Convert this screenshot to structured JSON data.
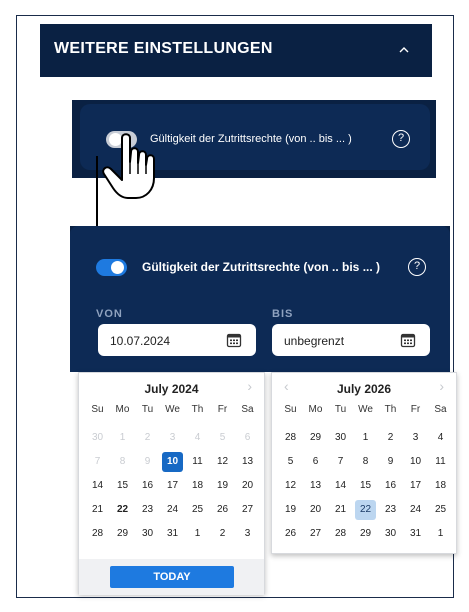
{
  "header": {
    "title": "WEITERE EINSTELLUNGEN",
    "chevron_icon": "chevron-up-icon"
  },
  "before": {
    "toggle_state": "off",
    "label": "Gültigkeit der Zutrittsrechte (von .. bis ... )",
    "help": "?"
  },
  "after": {
    "toggle_state": "on",
    "label": "Gültigkeit der Zutrittsrechte (von .. bis ... )",
    "help": "?",
    "von": {
      "label": "VON",
      "value": "10.07.2024"
    },
    "bis": {
      "label": "BIS",
      "value": "unbegrenzt"
    }
  },
  "cal_left": {
    "title": "July 2024",
    "days_of_week": [
      "Su",
      "Mo",
      "Tu",
      "We",
      "Th",
      "Fr",
      "Sa"
    ],
    "weeks": [
      [
        {
          "d": "30",
          "m": 1
        },
        {
          "d": "1",
          "m": 1
        },
        {
          "d": "2",
          "m": 1
        },
        {
          "d": "3",
          "m": 1
        },
        {
          "d": "4",
          "m": 1
        },
        {
          "d": "5",
          "m": 1
        },
        {
          "d": "6",
          "m": 1
        }
      ],
      [
        {
          "d": "7",
          "m": 1
        },
        {
          "d": "8",
          "m": 1
        },
        {
          "d": "9",
          "m": 1
        },
        {
          "d": "10",
          "s": 1
        },
        {
          "d": "11"
        },
        {
          "d": "12"
        },
        {
          "d": "13"
        }
      ],
      [
        {
          "d": "14"
        },
        {
          "d": "15"
        },
        {
          "d": "16"
        },
        {
          "d": "17"
        },
        {
          "d": "18"
        },
        {
          "d": "19"
        },
        {
          "d": "20"
        }
      ],
      [
        {
          "d": "21"
        },
        {
          "d": "22",
          "t": 1
        },
        {
          "d": "23"
        },
        {
          "d": "24"
        },
        {
          "d": "25"
        },
        {
          "d": "26"
        },
        {
          "d": "27"
        }
      ],
      [
        {
          "d": "28"
        },
        {
          "d": "29"
        },
        {
          "d": "30"
        },
        {
          "d": "31"
        },
        {
          "d": "1"
        },
        {
          "d": "2"
        },
        {
          "d": "3"
        }
      ]
    ],
    "today_label": "TODAY"
  },
  "cal_right": {
    "title": "July 2026",
    "days_of_week": [
      "Su",
      "Mo",
      "Tu",
      "We",
      "Th",
      "Fr",
      "Sa"
    ],
    "weeks": [
      [
        {
          "d": "28"
        },
        {
          "d": "29"
        },
        {
          "d": "30"
        },
        {
          "d": "1"
        },
        {
          "d": "2"
        },
        {
          "d": "3"
        },
        {
          "d": "4"
        }
      ],
      [
        {
          "d": "5"
        },
        {
          "d": "6"
        },
        {
          "d": "7"
        },
        {
          "d": "8"
        },
        {
          "d": "9"
        },
        {
          "d": "10"
        },
        {
          "d": "11"
        }
      ],
      [
        {
          "d": "12"
        },
        {
          "d": "13"
        },
        {
          "d": "14"
        },
        {
          "d": "15"
        },
        {
          "d": "16"
        },
        {
          "d": "17"
        },
        {
          "d": "18"
        }
      ],
      [
        {
          "d": "19"
        },
        {
          "d": "20"
        },
        {
          "d": "21"
        },
        {
          "d": "22",
          "h": 1
        },
        {
          "d": "23"
        },
        {
          "d": "24"
        },
        {
          "d": "25"
        }
      ],
      [
        {
          "d": "26"
        },
        {
          "d": "27"
        },
        {
          "d": "28"
        },
        {
          "d": "29"
        },
        {
          "d": "30"
        },
        {
          "d": "31"
        },
        {
          "d": "1"
        }
      ]
    ]
  },
  "colors": {
    "navy": "#0a2143",
    "panel": "#0d2a55",
    "accent": "#1e7ae0",
    "selected": "#1769c4",
    "highlight": "#bcd6f0"
  }
}
